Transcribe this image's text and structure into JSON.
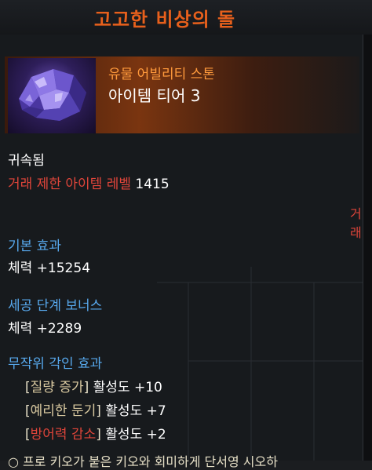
{
  "window": {
    "title": "고고한 비상의 돌"
  },
  "item": {
    "grade": "유물 어빌리티 스톤",
    "tier": "아이템 티어 3",
    "icon": "crystal-stone-icon"
  },
  "info": {
    "bound": "귀속됨",
    "req_level_label": "거래 제한 아이템 레벨",
    "req_level_value": "1415",
    "cut_side_text": "거래"
  },
  "base_effect": {
    "heading": "기본 효과",
    "line": "체력 +15254"
  },
  "bonus": {
    "heading": "세공 단계 보너스",
    "line": "체력 +2289"
  },
  "engravings": {
    "heading": "무작위 각인 효과",
    "items": [
      {
        "bracket_open": "[",
        "name": "질량 증가",
        "bracket_close": "]",
        "effect": "활성도 +10"
      },
      {
        "bracket_open": "[",
        "name": "예리한 둔기",
        "bracket_close": "]",
        "effect": "활성도 +7"
      },
      {
        "bracket_open": "[",
        "name": "방어력 감소",
        "bracket_close": "]",
        "effect": "활성도 +2"
      }
    ]
  },
  "bottom_cut_text": "○ 프로 키오가 붙은 키오와 회미하게 단서영 시오하",
  "colors": {
    "title": "#e8601c",
    "grade": "#ff9a3c",
    "section": "#57a8ec",
    "warning": "#e0453a",
    "engrave_positive": "#d9c9a0",
    "engrave_negative": "#e0453a"
  }
}
